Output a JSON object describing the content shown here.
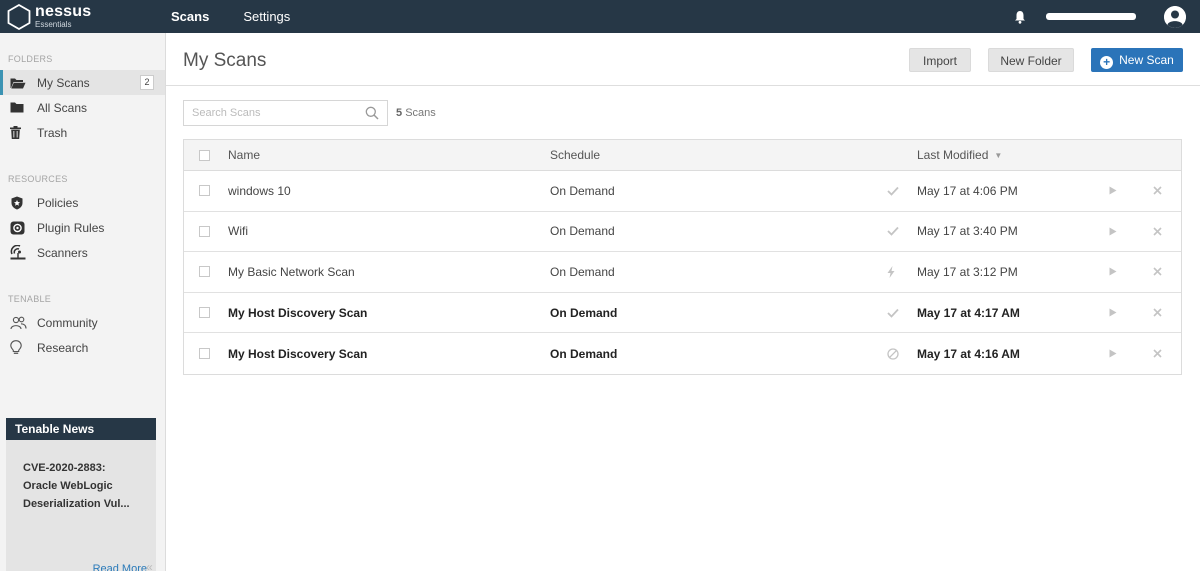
{
  "app": {
    "logo_name": "nessus",
    "logo_sub": "Essentials",
    "nav": [
      {
        "label": "Scans",
        "active": true
      },
      {
        "label": "Settings",
        "active": false
      }
    ]
  },
  "sidebar": {
    "folders_title": "FOLDERS",
    "folders": [
      {
        "label": "My Scans",
        "icon": "folder-open-icon",
        "badge": "2",
        "active": true
      },
      {
        "label": "All Scans",
        "icon": "folder-icon"
      },
      {
        "label": "Trash",
        "icon": "trash-icon"
      }
    ],
    "resources_title": "RESOURCES",
    "resources": [
      {
        "label": "Policies",
        "icon": "policy-icon"
      },
      {
        "label": "Plugin Rules",
        "icon": "plugin-rules-icon"
      },
      {
        "label": "Scanners",
        "icon": "scanner-icon"
      }
    ],
    "tenable_title": "TENABLE",
    "tenable": [
      {
        "label": "Community",
        "icon": "community-icon"
      },
      {
        "label": "Research",
        "icon": "research-icon"
      }
    ],
    "news": {
      "title": "Tenable News",
      "headline": "CVE-2020-2883: Oracle WebLogic Deserialization Vul...",
      "read_more": "Read More"
    },
    "collapse_icon": "«"
  },
  "main": {
    "title": "My Scans",
    "buttons": {
      "import": "Import",
      "new_folder": "New Folder",
      "new_scan": "New Scan"
    },
    "search_placeholder": "Search Scans",
    "count_number": "5",
    "count_label": "Scans",
    "table": {
      "headers": {
        "name": "Name",
        "schedule": "Schedule",
        "last_modified": "Last Modified"
      },
      "rows": [
        {
          "name": "windows 10",
          "schedule": "On Demand",
          "status_icon": "check-icon",
          "modified": "May 17 at 4:06 PM",
          "bold": false
        },
        {
          "name": "Wifi",
          "schedule": "On Demand",
          "status_icon": "check-icon",
          "modified": "May 17 at 3:40 PM",
          "bold": false
        },
        {
          "name": "My Basic Network Scan",
          "schedule": "On Demand",
          "status_icon": "bolt-icon",
          "modified": "May 17 at 3:12 PM",
          "bold": false
        },
        {
          "name": "My Host Discovery Scan",
          "schedule": "On Demand",
          "status_icon": "check-icon",
          "modified": "May 17 at 4:17 AM",
          "bold": true
        },
        {
          "name": "My Host Discovery Scan",
          "schedule": "On Demand",
          "status_icon": "canceled-icon",
          "modified": "May 17 at 4:16 AM",
          "bold": true
        }
      ]
    }
  },
  "colors": {
    "topbar": "#263746",
    "accent": "#2b74b9",
    "sidebar_bg": "#f3f3f3"
  }
}
